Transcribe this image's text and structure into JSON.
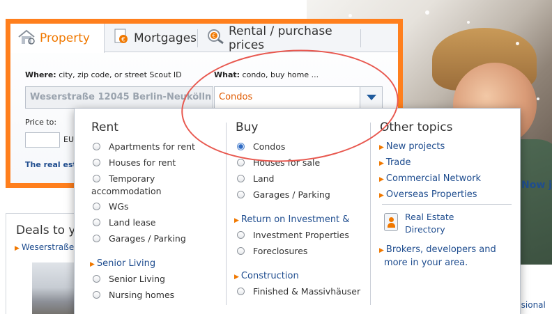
{
  "tabs": [
    {
      "label": "Property",
      "icon": "house-icon"
    },
    {
      "label": "Mortgages",
      "icon": "euro-document-icon"
    },
    {
      "label": "Rental / purchase prices",
      "icon": "euro-magnifier-icon"
    }
  ],
  "search": {
    "where_label_bold": "Where:",
    "where_label_rest": " city, zip code, or street Scout ID",
    "where_value": "Weserstraße 12045 Berlin-Neukölln",
    "what_label_bold": "What:",
    "what_label_rest": " condo, buy home ...",
    "what_value": "Condos",
    "price_label": "Price to:",
    "currency_partial": "EU",
    "link_partial": "The real esta"
  },
  "dropdown": {
    "rent": {
      "title": "Rent",
      "options": [
        "Apartments for rent",
        "Houses for rent",
        "Temporary",
        "accommodation",
        "WGs",
        "Land lease",
        "Garages / Parking"
      ],
      "subheading": "Senior Living",
      "sub_options": [
        "Senior Living",
        "Nursing homes"
      ]
    },
    "buy": {
      "title": "Buy",
      "options": [
        "Condos",
        "Houses for sale",
        "Land",
        "Garages / Parking"
      ],
      "selected": "Condos",
      "subheading_1": "Return on Investment &",
      "sub_options_1": [
        "Investment Properties",
        "Foreclosures"
      ],
      "subheading_2": "Construction",
      "sub_options_2": [
        "Finished & Massivhäuser"
      ]
    },
    "other": {
      "title": "Other topics",
      "links": [
        "New projects",
        "Trade",
        "Commercial Network",
        "Overseas Properties"
      ],
      "directory_line1": "Real Estate",
      "directory_line2": "Directory",
      "brokers_line1": "Brokers, developers and",
      "brokers_line2": "more in your area."
    }
  },
  "deals": {
    "title_partial": "Deals to yo",
    "link_partial": "Weserstraße/"
  },
  "side": {
    "now_partial": "Now j",
    "professional_partial": "essional"
  },
  "colors": {
    "accent_orange": "#ff7f1d",
    "link_blue": "#1f4d8f",
    "annotation_red": "#e8584f"
  }
}
